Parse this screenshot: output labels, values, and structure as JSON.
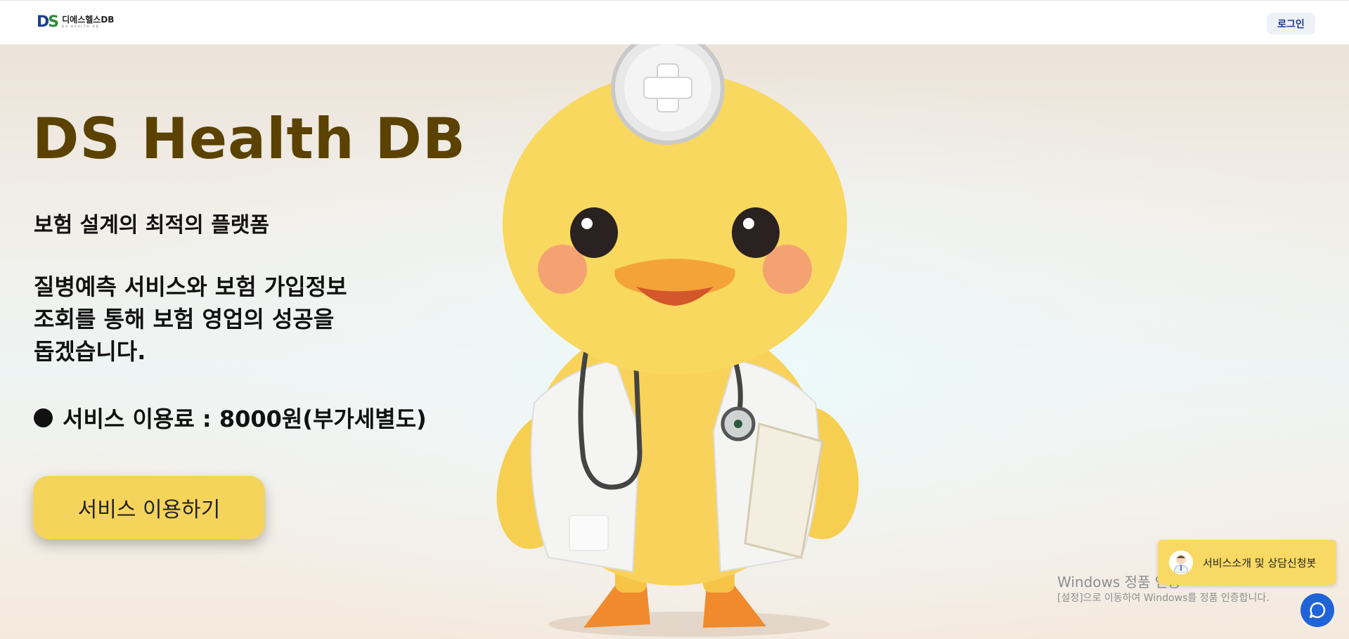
{
  "header": {
    "logo_text": "디에스헬스DB",
    "logo_subtext": "DS HEALTH DB",
    "logo_mark_d": "D",
    "logo_mark_s": "S",
    "login_label": "로그인"
  },
  "hero": {
    "title": "DS Health DB",
    "subtitle": "보험 설계의 최적의 플랫폼",
    "description_lines": [
      "질병예측 서비스와 보험 가입정보",
      "조회를 통해 보험 영업의 성공을",
      "돕겠습니다."
    ],
    "fee": "서비스 이용료 : 8000원(부가세별도)",
    "cta_label": "서비스 이용하기"
  },
  "chatbot": {
    "banner_label": "서비스소개 및 상담신청봇",
    "fab_icon": "chat-bubble-icon"
  },
  "windows_activation": {
    "title": "Windows 정품 인증",
    "message": "[설정]으로 이동하여 Windows를 정품 인증합니다."
  },
  "colors": {
    "title": "#5b4200",
    "cta": "#f5d45c",
    "chatbot_banner": "#f8d963",
    "fab": "#1f63d8",
    "login_text": "#1d3b8b"
  }
}
